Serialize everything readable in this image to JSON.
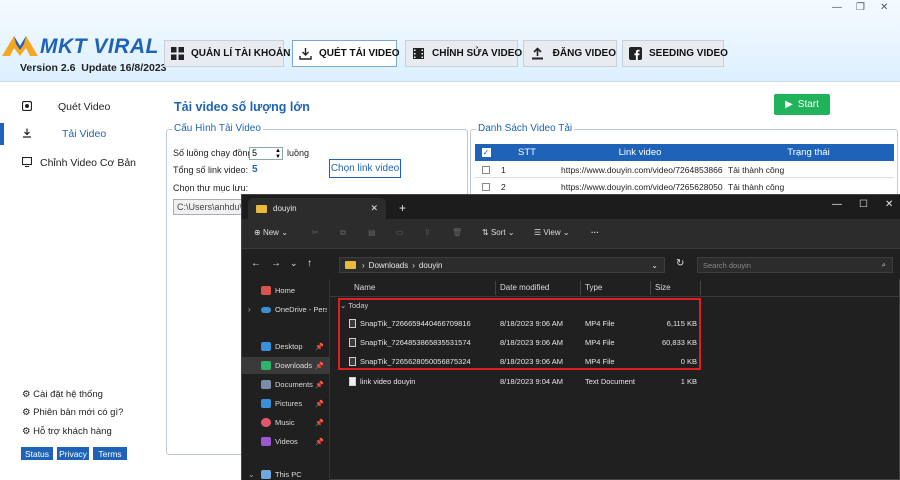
{
  "app": {
    "window_controls": {
      "min": "—",
      "restore": "❐",
      "close": "✕"
    },
    "logo_text": "MKT VIRAL",
    "version_label": "Version  2.6",
    "update_label": "Update 16/8/2023",
    "nav": [
      {
        "label": "QUẢN LÍ TÀI KHOẢN",
        "icon": "grid-icon"
      },
      {
        "label": "QUÉT TẢI VIDEO",
        "icon": "download-icon"
      },
      {
        "label": "CHỈNH SỬA VIDEO",
        "icon": "film-icon"
      },
      {
        "label": "ĐĂNG VIDEO",
        "icon": "upload-icon"
      },
      {
        "label": "SEEDING VIDEO",
        "icon": "facebook-icon"
      }
    ],
    "sidebar": {
      "items": [
        {
          "label": "Quét Video",
          "icon": "camera-icon"
        },
        {
          "label": "Tải Video",
          "icon": "download-icon"
        },
        {
          "label": "Chỉnh Video Cơ Bản",
          "icon": "monitor-icon"
        }
      ],
      "bottom_links": [
        "Cài đặt hệ thống",
        "Phiên bản mới có gì?",
        "Hỗ trợ khách hàng"
      ],
      "chips": [
        "Status",
        "Privacy",
        "Terms"
      ]
    },
    "main": {
      "title": "Tải video số lượng lớn",
      "start_label": "Start",
      "config": {
        "legend": "Cấu Hình Tải Video",
        "threads_label": "Số luồng chạy đồng t",
        "threads_value": "5",
        "threads_unit": "luồng",
        "total_label": "Tổng số link video:",
        "total_value": "5",
        "choose_link_label": "Chọn link video",
        "folder_label": "Chọn thư mục lưu:",
        "folder_value": "C:\\Users\\anhdu\\"
      },
      "list": {
        "legend": "Danh Sách Video Tải",
        "headers": [
          "STT",
          "Link video",
          "Trạng thái"
        ],
        "rows": [
          {
            "stt": "1",
            "link": "https://www.douyin.com/video/7264853866...",
            "status": "Tải thành công"
          },
          {
            "stt": "2",
            "link": "https://www.douyin.com/video/7265628050...",
            "status": "Tải thành công"
          }
        ]
      }
    }
  },
  "explorer": {
    "tab_title": "douyin",
    "new_label": "New",
    "sort_label": "Sort",
    "view_label": "View",
    "more_label": "···",
    "breadcrumb": [
      "Downloads",
      "douyin"
    ],
    "search_placeholder": "Search douyin",
    "nav_items": [
      {
        "label": "Home",
        "color": "#d9534f",
        "pin": false
      },
      {
        "label": "OneDrive - Perso",
        "color": "#3a8fd9",
        "pin": false
      },
      {
        "label": "Desktop",
        "color": "#3a8fd9",
        "pin": true
      },
      {
        "label": "Downloads",
        "color": "#2fb36b",
        "pin": true
      },
      {
        "label": "Documents",
        "color": "#7a8ca8",
        "pin": true
      },
      {
        "label": "Pictures",
        "color": "#3a8fd9",
        "pin": true
      },
      {
        "label": "Music",
        "color": "#e0566b",
        "pin": true
      },
      {
        "label": "Videos",
        "color": "#9b59d0",
        "pin": true
      },
      {
        "label": "This PC",
        "color": "#6fa8dc",
        "pin": false
      }
    ],
    "columns": [
      "Name",
      "Date modified",
      "Type",
      "Size"
    ],
    "group_label": "Today",
    "files": [
      {
        "name": "SnapTik_7266659440466709816",
        "date": "8/18/2023 9:06 AM",
        "type": "MP4 File",
        "size": "6,115 KB"
      },
      {
        "name": "SnapTik_7264853865835531574",
        "date": "8/18/2023 9:06 AM",
        "type": "MP4 File",
        "size": "60,833 KB"
      },
      {
        "name": "SnapTik_7265628050056875324",
        "date": "8/18/2023 9:06 AM",
        "type": "MP4 File",
        "size": "0 KB"
      },
      {
        "name": "link video douyin",
        "date": "8/18/2023 9:04 AM",
        "type": "Text Document",
        "size": "1 KB"
      }
    ],
    "highlight_color": "#e02020"
  }
}
